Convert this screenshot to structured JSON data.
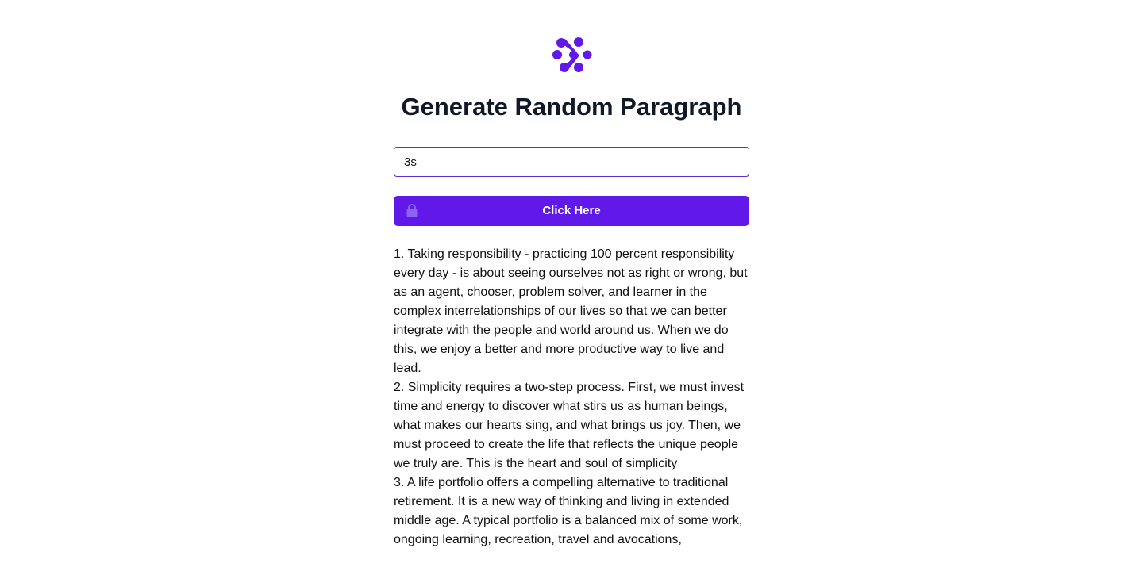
{
  "header": {
    "logo_icon": "dots-network-logo-icon",
    "title": "Generate Random Paragraph"
  },
  "form": {
    "input_value": "3s",
    "button_label": "Click Here",
    "button_icon": "lock-icon"
  },
  "output": {
    "paragraphs": [
      "1. Taking responsibility - practicing 100 percent responsibility every day - is about seeing ourselves not as right or wrong, but as an agent, chooser, problem solver, and learner in the complex interrelationships of our lives so that we can better integrate with the people and world around us. When we do this, we enjoy a better and more productive way to live and lead.",
      "2. Simplicity requires a two-step process. First, we must invest time and energy to discover what stirs us as human beings, what makes our hearts sing, and what brings us joy. Then, we must proceed to create the life that reflects the unique people we truly are. This is the heart and soul of simplicity",
      "3. A life portfolio offers a compelling alternative to traditional retirement. It is a new way of thinking and living in extended middle age. A typical portfolio is a balanced mix of some work, ongoing learning, recreation, travel and avocations,"
    ]
  },
  "colors": {
    "accent": "#6119ea",
    "input_border": "#5b2ddb",
    "title": "#111827"
  }
}
